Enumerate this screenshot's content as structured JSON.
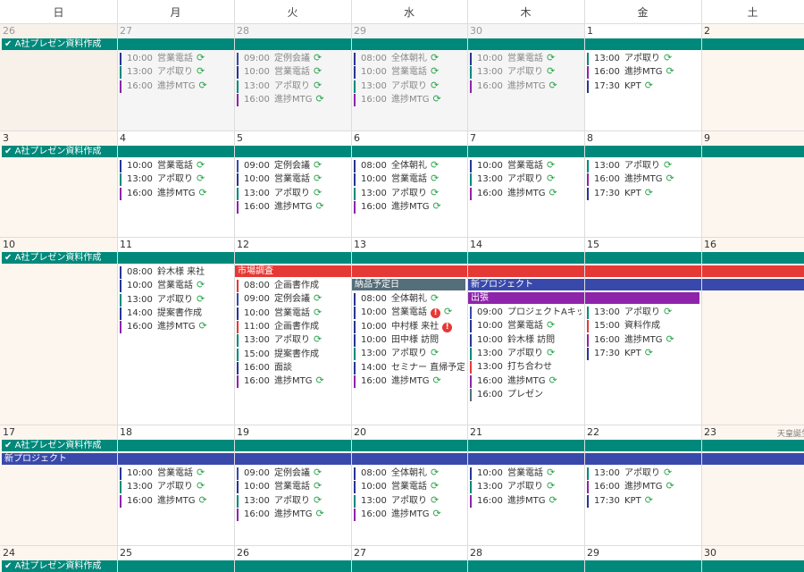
{
  "weekdays": [
    "日",
    "月",
    "火",
    "水",
    "木",
    "金",
    "土"
  ],
  "colors": {
    "teal": "#00897b",
    "navy": "#283593",
    "blue": "#3949ab",
    "purple": "#8e24aa",
    "red": "#e53935",
    "slate": "#546e7a",
    "grey": "#757575"
  },
  "weeks": [
    {
      "days": [
        "26",
        "27",
        "28",
        "29",
        "30",
        "1",
        "2"
      ],
      "bars": [
        {
          "label": "A社プレゼン資料作成",
          "check": true,
          "color": "teal",
          "start": 0,
          "span": 7
        }
      ],
      "events": [
        {
          "col": 1,
          "items": [
            {
              "time": "10:00",
              "title": "営業電話",
              "color": "navy",
              "rep": true
            },
            {
              "time": "13:00",
              "title": "アポ取り",
              "color": "teal",
              "rep": true
            },
            {
              "time": "16:00",
              "title": "進捗MTG",
              "color": "purple",
              "rep": true
            }
          ]
        },
        {
          "col": 2,
          "items": [
            {
              "time": "09:00",
              "title": "定例会議",
              "color": "blue",
              "rep": true
            },
            {
              "time": "10:00",
              "title": "営業電話",
              "color": "navy",
              "rep": true
            },
            {
              "time": "13:00",
              "title": "アポ取り",
              "color": "teal",
              "rep": true
            },
            {
              "time": "16:00",
              "title": "進捗MTG",
              "color": "purple",
              "rep": true
            }
          ]
        },
        {
          "col": 3,
          "items": [
            {
              "time": "08:00",
              "title": "全体朝礼",
              "color": "navy",
              "rep": true
            },
            {
              "time": "10:00",
              "title": "営業電話",
              "color": "navy",
              "rep": true
            },
            {
              "time": "13:00",
              "title": "アポ取り",
              "color": "teal",
              "rep": true
            },
            {
              "time": "16:00",
              "title": "進捗MTG",
              "color": "purple",
              "rep": true
            }
          ]
        },
        {
          "col": 4,
          "items": [
            {
              "time": "10:00",
              "title": "営業電話",
              "color": "navy",
              "rep": true
            },
            {
              "time": "13:00",
              "title": "アポ取り",
              "color": "teal",
              "rep": true
            },
            {
              "time": "16:00",
              "title": "進捗MTG",
              "color": "purple",
              "rep": true
            }
          ]
        },
        {
          "col": 5,
          "items": [
            {
              "time": "13:00",
              "title": "アポ取り",
              "color": "teal",
              "rep": true
            },
            {
              "time": "16:00",
              "title": "進捗MTG",
              "color": "purple",
              "rep": true
            },
            {
              "time": "17:30",
              "title": "KPT",
              "color": "navy",
              "rep": true
            }
          ]
        }
      ]
    },
    {
      "days": [
        "3",
        "4",
        "5",
        "6",
        "7",
        "8",
        "9"
      ],
      "bars": [
        {
          "label": "A社プレゼン資料作成",
          "check": true,
          "color": "teal",
          "start": 0,
          "span": 7
        }
      ],
      "events": [
        {
          "col": 1,
          "items": [
            {
              "time": "10:00",
              "title": "営業電話",
              "color": "navy",
              "rep": true
            },
            {
              "time": "13:00",
              "title": "アポ取り",
              "color": "teal",
              "rep": true
            },
            {
              "time": "16:00",
              "title": "進捗MTG",
              "color": "purple",
              "rep": true
            }
          ]
        },
        {
          "col": 2,
          "items": [
            {
              "time": "09:00",
              "title": "定例会議",
              "color": "blue",
              "rep": true
            },
            {
              "time": "10:00",
              "title": "営業電話",
              "color": "navy",
              "rep": true
            },
            {
              "time": "13:00",
              "title": "アポ取り",
              "color": "teal",
              "rep": true
            },
            {
              "time": "16:00",
              "title": "進捗MTG",
              "color": "purple",
              "rep": true
            }
          ]
        },
        {
          "col": 3,
          "items": [
            {
              "time": "08:00",
              "title": "全体朝礼",
              "color": "navy",
              "rep": true
            },
            {
              "time": "10:00",
              "title": "営業電話",
              "color": "navy",
              "rep": true
            },
            {
              "time": "13:00",
              "title": "アポ取り",
              "color": "teal",
              "rep": true
            },
            {
              "time": "16:00",
              "title": "進捗MTG",
              "color": "purple",
              "rep": true
            }
          ]
        },
        {
          "col": 4,
          "items": [
            {
              "time": "10:00",
              "title": "営業電話",
              "color": "navy",
              "rep": true
            },
            {
              "time": "13:00",
              "title": "アポ取り",
              "color": "teal",
              "rep": true
            },
            {
              "time": "16:00",
              "title": "進捗MTG",
              "color": "purple",
              "rep": true
            }
          ]
        },
        {
          "col": 5,
          "items": [
            {
              "time": "13:00",
              "title": "アポ取り",
              "color": "teal",
              "rep": true
            },
            {
              "time": "16:00",
              "title": "進捗MTG",
              "color": "purple",
              "rep": true
            },
            {
              "time": "17:30",
              "title": "KPT",
              "color": "navy",
              "rep": true
            }
          ]
        }
      ]
    },
    {
      "days": [
        "10",
        "11",
        "12",
        "13",
        "14",
        "15",
        "16"
      ],
      "bars": [
        {
          "label": "A社プレゼン資料作成",
          "check": true,
          "color": "teal",
          "start": 0,
          "span": 7
        },
        {
          "label": "市場調査",
          "color": "red",
          "start": 2,
          "span": 5,
          "lane": 1
        },
        {
          "label": "納品予定日",
          "color": "slate",
          "start": 3,
          "span": 1,
          "lane": 2
        },
        {
          "label": "新プロジェクト",
          "color": "blue",
          "start": 4,
          "span": 3,
          "lane": 2
        },
        {
          "label": "出張",
          "color": "purple",
          "start": 4,
          "span": 2,
          "lane": 3
        }
      ],
      "events": [
        {
          "col": 1,
          "lane": 1,
          "items": [
            {
              "time": "08:00",
              "title": "鈴木様 来社",
              "color": "navy"
            },
            {
              "time": "10:00",
              "title": "営業電話",
              "color": "navy",
              "rep": true
            },
            {
              "time": "13:00",
              "title": "アポ取り",
              "color": "teal",
              "rep": true
            },
            {
              "time": "14:00",
              "title": "提案書作成",
              "color": "navy"
            },
            {
              "time": "16:00",
              "title": "進捗MTG",
              "color": "purple",
              "rep": true
            }
          ]
        },
        {
          "col": 2,
          "lane": 2,
          "items": [
            {
              "time": "08:00",
              "title": "企画書作成",
              "color": "red"
            },
            {
              "time": "09:00",
              "title": "定例会議",
              "color": "blue",
              "rep": true
            },
            {
              "time": "10:00",
              "title": "営業電話",
              "color": "navy",
              "rep": true
            },
            {
              "time": "11:00",
              "title": "企画書作成",
              "color": "red"
            },
            {
              "time": "13:00",
              "title": "アポ取り",
              "color": "teal",
              "rep": true
            },
            {
              "time": "15:00",
              "title": "提案書作成",
              "color": "teal"
            },
            {
              "time": "16:00",
              "title": "面談",
              "color": "navy"
            },
            {
              "time": "16:00",
              "title": "進捗MTG",
              "color": "purple",
              "rep": true
            }
          ]
        },
        {
          "col": 3,
          "lane": 3,
          "items": [
            {
              "time": "08:00",
              "title": "全体朝礼",
              "color": "navy",
              "rep": true
            },
            {
              "time": "10:00",
              "title": "営業電話",
              "color": "navy",
              "alert": true,
              "rep": true
            },
            {
              "time": "10:00",
              "title": "中村様 来社",
              "color": "navy",
              "alert": true
            },
            {
              "time": "10:00",
              "title": "田中様 訪問",
              "color": "navy"
            },
            {
              "time": "13:00",
              "title": "アポ取り",
              "color": "teal",
              "rep": true
            },
            {
              "time": "14:00",
              "title": "セミナー 直帰予定",
              "color": "navy"
            },
            {
              "time": "16:00",
              "title": "進捗MTG",
              "color": "purple",
              "rep": true
            }
          ]
        },
        {
          "col": 4,
          "lane": 4,
          "items": [
            {
              "time": "09:00",
              "title": "プロジェクトAキッ",
              "color": "blue"
            },
            {
              "time": "10:00",
              "title": "営業電話",
              "color": "navy",
              "rep": true
            },
            {
              "time": "10:00",
              "title": "鈴木様 訪問",
              "color": "navy"
            },
            {
              "time": "13:00",
              "title": "アポ取り",
              "color": "teal",
              "rep": true
            },
            {
              "time": "13:00",
              "title": "打ち合わせ",
              "color": "red"
            },
            {
              "time": "16:00",
              "title": "進捗MTG",
              "color": "purple",
              "rep": true
            },
            {
              "time": "16:00",
              "title": "プレゼン",
              "color": "slate"
            }
          ]
        },
        {
          "col": 5,
          "lane": 4,
          "items": [
            {
              "time": "13:00",
              "title": "アポ取り",
              "color": "teal",
              "rep": true
            },
            {
              "time": "15:00",
              "title": "資料作成",
              "color": "red"
            },
            {
              "time": "16:00",
              "title": "進捗MTG",
              "color": "purple",
              "rep": true
            },
            {
              "time": "17:30",
              "title": "KPT",
              "color": "navy",
              "rep": true
            }
          ]
        }
      ]
    },
    {
      "days": [
        "17",
        "18",
        "19",
        "20",
        "21",
        "22",
        "23"
      ],
      "holiday": {
        "col": 6,
        "label": "天皇誕生"
      },
      "bars": [
        {
          "label": "A社プレゼン資料作成",
          "check": true,
          "color": "teal",
          "start": 0,
          "span": 7
        },
        {
          "label": "新プロジェクト",
          "color": "blue",
          "start": 0,
          "span": 7,
          "lane": 1
        }
      ],
      "events": [
        {
          "col": 1,
          "lane": 2,
          "items": [
            {
              "time": "10:00",
              "title": "営業電話",
              "color": "navy",
              "rep": true
            },
            {
              "time": "13:00",
              "title": "アポ取り",
              "color": "teal",
              "rep": true
            },
            {
              "time": "16:00",
              "title": "進捗MTG",
              "color": "purple",
              "rep": true
            }
          ]
        },
        {
          "col": 2,
          "lane": 2,
          "items": [
            {
              "time": "09:00",
              "title": "定例会議",
              "color": "blue",
              "rep": true
            },
            {
              "time": "10:00",
              "title": "営業電話",
              "color": "navy",
              "rep": true
            },
            {
              "time": "13:00",
              "title": "アポ取り",
              "color": "teal",
              "rep": true
            },
            {
              "time": "16:00",
              "title": "進捗MTG",
              "color": "purple",
              "rep": true
            }
          ]
        },
        {
          "col": 3,
          "lane": 2,
          "items": [
            {
              "time": "08:00",
              "title": "全体朝礼",
              "color": "navy",
              "rep": true
            },
            {
              "time": "10:00",
              "title": "営業電話",
              "color": "navy",
              "rep": true
            },
            {
              "time": "13:00",
              "title": "アポ取り",
              "color": "teal",
              "rep": true
            },
            {
              "time": "16:00",
              "title": "進捗MTG",
              "color": "purple",
              "rep": true
            }
          ]
        },
        {
          "col": 4,
          "lane": 2,
          "items": [
            {
              "time": "10:00",
              "title": "営業電話",
              "color": "navy",
              "rep": true
            },
            {
              "time": "13:00",
              "title": "アポ取り",
              "color": "teal",
              "rep": true
            },
            {
              "time": "16:00",
              "title": "進捗MTG",
              "color": "purple",
              "rep": true
            }
          ]
        },
        {
          "col": 5,
          "lane": 2,
          "items": [
            {
              "time": "13:00",
              "title": "アポ取り",
              "color": "teal",
              "rep": true
            },
            {
              "time": "16:00",
              "title": "進捗MTG",
              "color": "purple",
              "rep": true
            },
            {
              "time": "17:30",
              "title": "KPT",
              "color": "navy",
              "rep": true
            }
          ]
        }
      ]
    },
    {
      "days": [
        "24",
        "25",
        "26",
        "27",
        "28",
        "29",
        "30"
      ],
      "bars": [
        {
          "label": "A社プレゼン資料作成",
          "check": true,
          "color": "teal",
          "start": 0,
          "span": 7
        }
      ],
      "events": []
    }
  ]
}
